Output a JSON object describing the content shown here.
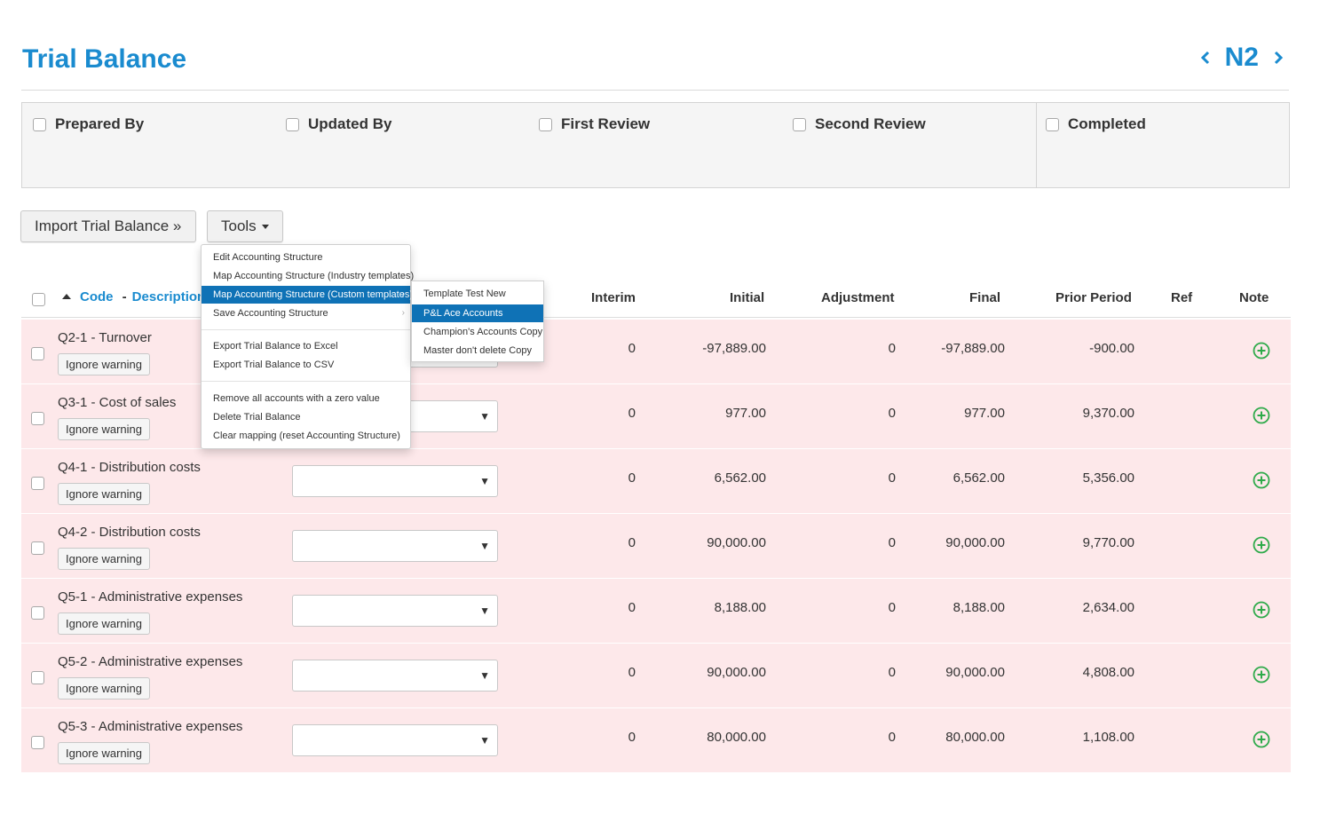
{
  "page": {
    "title": "Trial Balance",
    "code": "N2"
  },
  "signoff": [
    {
      "label": "Prepared By"
    },
    {
      "label": "Updated By"
    },
    {
      "label": "First Review"
    },
    {
      "label": "Second Review"
    },
    {
      "label": "Completed"
    }
  ],
  "toolbar": {
    "import_label": "Import Trial Balance »",
    "tools_label": "Tools"
  },
  "table": {
    "headers": {
      "code": "Code",
      "separator": "-",
      "description": "Description",
      "interim": "Interim",
      "initial": "Initial",
      "adjustment": "Adjustment",
      "final": "Final",
      "prior_period": "Prior Period",
      "ref": "Ref",
      "note": "Note"
    },
    "ignore_warning_label": "Ignore warning",
    "rows": [
      {
        "desc": "Q2-1 - Turnover",
        "interim": "0",
        "initial": "-97,889.00",
        "adjustment": "0",
        "final": "-97,889.00",
        "prior": "-900.00"
      },
      {
        "desc": "Q3-1 - Cost of sales",
        "interim": "0",
        "initial": "977.00",
        "adjustment": "0",
        "final": "977.00",
        "prior": "9,370.00"
      },
      {
        "desc": "Q4-1 - Distribution costs",
        "interim": "0",
        "initial": "6,562.00",
        "adjustment": "0",
        "final": "6,562.00",
        "prior": "5,356.00"
      },
      {
        "desc": "Q4-2 - Distribution costs",
        "interim": "0",
        "initial": "90,000.00",
        "adjustment": "0",
        "final": "90,000.00",
        "prior": "9,770.00"
      },
      {
        "desc": "Q5-1 - Administrative expenses",
        "interim": "0",
        "initial": "8,188.00",
        "adjustment": "0",
        "final": "8,188.00",
        "prior": "2,634.00"
      },
      {
        "desc": "Q5-2 - Administrative expenses",
        "interim": "0",
        "initial": "90,000.00",
        "adjustment": "0",
        "final": "90,000.00",
        "prior": "4,808.00"
      },
      {
        "desc": "Q5-3 - Administrative expenses",
        "interim": "0",
        "initial": "80,000.00",
        "adjustment": "0",
        "final": "80,000.00",
        "prior": "1,108.00"
      }
    ]
  },
  "tools_menu": {
    "items": [
      {
        "label": "Edit Accounting Structure",
        "has_submenu": false
      },
      {
        "label": "Map Accounting Structure (Industry templates)",
        "has_submenu": true
      },
      {
        "label": "Map Accounting Structure (Custom templates)",
        "has_submenu": true,
        "active": true
      },
      {
        "label": "Save Accounting Structure",
        "has_submenu": true
      },
      {
        "label": "Export Trial Balance to Excel",
        "has_submenu": false
      },
      {
        "label": "Export Trial Balance to CSV",
        "has_submenu": false
      },
      {
        "label": "Remove all accounts with a zero value",
        "has_submenu": false
      },
      {
        "label": "Delete Trial Balance",
        "has_submenu": false
      },
      {
        "label": "Clear mapping (reset Accounting Structure)",
        "has_submenu": false
      }
    ],
    "submenu_indicator": "›"
  },
  "custom_templates_submenu": {
    "items": [
      {
        "label": "Template Test New"
      },
      {
        "label": "P&L Ace Accounts",
        "active": true
      },
      {
        "label": "Champion's Accounts Copy"
      },
      {
        "label": "Master don't delete Copy"
      }
    ]
  },
  "colors": {
    "accent": "#1a8bcf",
    "row_warning_bg": "#fde8ea",
    "menu_highlight": "#0f72b6",
    "note_icon": "#2eaa4a"
  },
  "icons": {
    "nav_prev": "chevron-left-icon",
    "nav_next": "chevron-right-icon",
    "note": "plus-circle-icon",
    "select_arrow": "▼"
  }
}
